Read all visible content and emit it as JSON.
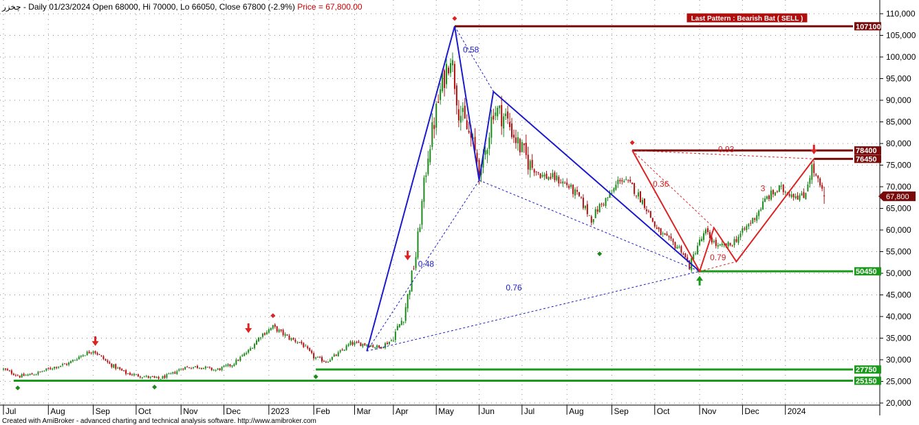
{
  "header": {
    "symbol": "چخزر",
    "info": " - Daily 01/23/2024 Open 68000, Hi 70000, Lo 66050, Close 67800 (-2.9%)",
    "price": " Price = 67,800.00"
  },
  "footer": "Created with AmiBroker - advanced charting and technical analysis software. http://www.amibroker.com",
  "last_pattern": "Last Pattern : Bearish Bat ( SELL )",
  "colors": {
    "up": "#1a8a1a",
    "down": "#b01010",
    "blue_pattern": "#1a1acc",
    "red_pattern": "#dd2222",
    "resistance": "#7a0a0a",
    "support": "#1a9a1a"
  },
  "chart_data": {
    "type": "candlestick",
    "title": "",
    "xlabel": "",
    "ylabel": "",
    "ylim": [
      20000,
      110000
    ],
    "y_ticks": [
      "20,000",
      "25,000",
      "30,000",
      "35,000",
      "40,000",
      "45,000",
      "50,000",
      "55,000",
      "60,000",
      "65,000",
      "70,000",
      "75,000",
      "80,000",
      "85,000",
      "90,000",
      "95,000",
      "100,000",
      "105,000",
      "110,000"
    ],
    "grid": true,
    "x_axis": [
      {
        "label": "Jul",
        "day": 0
      },
      {
        "label": "Aug",
        "day": 22
      },
      {
        "label": "Sep",
        "day": 44
      },
      {
        "label": "Oct",
        "day": 65
      },
      {
        "label": "Nov",
        "day": 87
      },
      {
        "label": "Dec",
        "day": 108
      },
      {
        "label": "2023",
        "day": 130
      },
      {
        "label": "Feb",
        "day": 152
      },
      {
        "label": "Mar",
        "day": 172
      },
      {
        "label": "Apr",
        "day": 191
      },
      {
        "label": "May",
        "day": 212
      },
      {
        "label": "Jun",
        "day": 233
      },
      {
        "label": "Jul",
        "day": 254
      },
      {
        "label": "Aug",
        "day": 276
      },
      {
        "label": "Sep",
        "day": 298
      },
      {
        "label": "Oct",
        "day": 319
      },
      {
        "label": "Nov",
        "day": 341
      },
      {
        "label": "Dec",
        "day": 362
      },
      {
        "label": "2024",
        "day": 383
      }
    ],
    "price_path": [
      [
        0,
        27800
      ],
      [
        8,
        26200
      ],
      [
        16,
        26800
      ],
      [
        24,
        28200
      ],
      [
        32,
        29200
      ],
      [
        38,
        31000
      ],
      [
        44,
        32200
      ],
      [
        52,
        29000
      ],
      [
        60,
        26900
      ],
      [
        68,
        26200
      ],
      [
        76,
        25600
      ],
      [
        82,
        26600
      ],
      [
        88,
        28200
      ],
      [
        96,
        28400
      ],
      [
        104,
        27600
      ],
      [
        112,
        28900
      ],
      [
        120,
        32000
      ],
      [
        126,
        35600
      ],
      [
        132,
        37600
      ],
      [
        140,
        35000
      ],
      [
        146,
        33800
      ],
      [
        152,
        30600
      ],
      [
        158,
        29600
      ],
      [
        164,
        31400
      ],
      [
        170,
        33800
      ],
      [
        178,
        33600
      ],
      [
        184,
        32800
      ],
      [
        190,
        34500
      ],
      [
        196,
        40000
      ],
      [
        202,
        54000
      ],
      [
        208,
        78000
      ],
      [
        214,
        92000
      ],
      [
        219,
        101000
      ],
      [
        223,
        88000
      ],
      [
        229,
        81000
      ],
      [
        234,
        73000
      ],
      [
        240,
        88000
      ],
      [
        246,
        86000
      ],
      [
        252,
        80000
      ],
      [
        258,
        75000
      ],
      [
        264,
        72500
      ],
      [
        270,
        72000
      ],
      [
        276,
        70500
      ],
      [
        282,
        67500
      ],
      [
        288,
        62500
      ],
      [
        292,
        65500
      ],
      [
        298,
        68500
      ],
      [
        302,
        72000
      ],
      [
        308,
        70000
      ],
      [
        314,
        66000
      ],
      [
        320,
        60000
      ],
      [
        326,
        57500
      ],
      [
        332,
        55500
      ],
      [
        336,
        51500
      ],
      [
        340,
        56500
      ],
      [
        344,
        59500
      ],
      [
        350,
        56000
      ],
      [
        356,
        56500
      ],
      [
        362,
        59500
      ],
      [
        368,
        63000
      ],
      [
        374,
        67500
      ],
      [
        380,
        69500
      ],
      [
        386,
        68500
      ],
      [
        392,
        67500
      ],
      [
        396,
        74500
      ],
      [
        400,
        70000
      ],
      [
        402,
        67800
      ]
    ],
    "ohlc_last": {
      "date": "01/23/2024",
      "open": 68000,
      "high": 70000,
      "low": 66050,
      "close": 67800,
      "change_pct": -2.9
    },
    "horizontal_levels": [
      {
        "label": "107100",
        "value": 107100,
        "color": "#7a0a0a",
        "start_day": 221
      },
      {
        "label": "78400",
        "value": 78400,
        "color": "#7a0a0a",
        "start_day": 308
      },
      {
        "label": "76450",
        "value": 76450,
        "color": "#7a0a0a",
        "start_day": 397
      },
      {
        "label": "50450",
        "value": 50450,
        "color": "#1a9a1a",
        "start_day": 340
      },
      {
        "label": "27750",
        "value": 27750,
        "color": "#1a9a1a",
        "start_day": 153
      },
      {
        "label": "25150",
        "value": 25150,
        "color": "#1a9a1a",
        "start_day": 5
      }
    ],
    "current_price_tag": {
      "label": "67,800",
      "value": 67800
    },
    "patterns": [
      {
        "name": "blue",
        "color": "#1a1acc",
        "points": [
          [
            178,
            32000
          ],
          [
            221,
            107100
          ],
          [
            233,
            71500
          ],
          [
            240,
            92000
          ],
          [
            341,
            50450
          ]
        ],
        "ratio_lines": [
          [
            [
              178,
              32000
            ],
            [
              233,
              71500
            ]
          ],
          [
            [
              221,
              107100
            ],
            [
              240,
              92000
            ]
          ],
          [
            [
              233,
              71500
            ],
            [
              341,
              50450
            ]
          ],
          [
            [
              178,
              32000
            ],
            [
              341,
              50450
            ]
          ]
        ],
        "ratios": [
          {
            "text": "0.58",
            "day": 229,
            "value": 101000
          },
          {
            "text": "0.48",
            "day": 207,
            "value": 51500
          },
          {
            "text": "0.76",
            "day": 250,
            "value": 46000
          }
        ]
      },
      {
        "name": "red",
        "color": "#dd2222",
        "points": [
          [
            308,
            78400
          ],
          [
            341,
            50450
          ],
          [
            348,
            60500
          ],
          [
            359,
            52700
          ],
          [
            397,
            76450
          ]
        ],
        "ratio_lines": [
          [
            [
              308,
              78400
            ],
            [
              348,
              60500
            ]
          ],
          [
            [
              341,
              50450
            ],
            [
              359,
              52700
            ]
          ],
          [
            [
              308,
              78400
            ],
            [
              397,
              76450
            ]
          ]
        ],
        "ratios": [
          {
            "text": "0.36",
            "day": 322,
            "value": 70000
          },
          {
            "text": "0.79",
            "day": 350,
            "value": 53000
          },
          {
            "text": "0.93",
            "day": 354,
            "value": 78000
          },
          {
            "text": "3",
            "day": 372,
            "value": 69000
          }
        ]
      }
    ],
    "signal_arrows": [
      {
        "dir": "down",
        "day": 45,
        "value": 33200,
        "color": "#dd2222"
      },
      {
        "dir": "down",
        "day": 120,
        "value": 36200,
        "color": "#dd2222"
      },
      {
        "dir": "down",
        "day": 198,
        "value": 53000,
        "color": "#dd2222"
      },
      {
        "dir": "down",
        "day": 397,
        "value": 77500,
        "color": "#dd2222"
      },
      {
        "dir": "up",
        "day": 341,
        "value": 49400,
        "color": "#1a9a1a"
      }
    ],
    "diamonds": [
      {
        "day": 221,
        "value": 108900,
        "color": "#dd2222"
      },
      {
        "day": 132,
        "value": 40200,
        "color": "#dd2222"
      },
      {
        "day": 308,
        "value": 80200,
        "color": "#dd2222"
      },
      {
        "day": 7,
        "value": 23500,
        "color": "#1a8a1a"
      },
      {
        "day": 74,
        "value": 23700,
        "color": "#1a8a1a"
      },
      {
        "day": 153,
        "value": 26100,
        "color": "#1a8a1a"
      },
      {
        "day": 292,
        "value": 54500,
        "color": "#1a8a1a"
      }
    ]
  }
}
